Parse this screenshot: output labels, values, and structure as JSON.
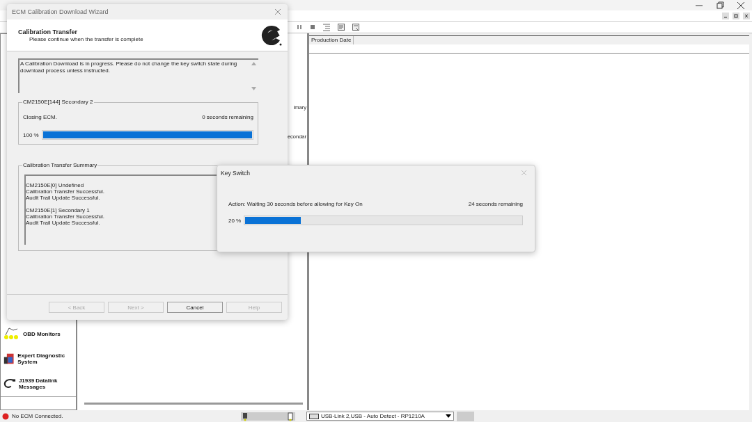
{
  "sidebar": {
    "items": [
      {
        "kind": "obd",
        "label": "OBD Monitors"
      },
      {
        "kind": "expert",
        "label": "Expert Diagnostic System"
      },
      {
        "kind": "datalink",
        "label": "J1939 Datalink Messages"
      }
    ]
  },
  "middle_pane": {
    "texts": [
      "imary",
      "econdar"
    ]
  },
  "table": {
    "columns": [
      "Production Date"
    ]
  },
  "status_bar": {
    "connection": "No ECM Connected.",
    "adapter": "USB-Link 2,USB - Auto Detect - RP1210A"
  },
  "wizard": {
    "title": "ECM Calibration Download Wizard",
    "heading": "Calibration Transfer",
    "subheading": "Please continue when the transfer is complete",
    "message": "A Calibration Download is in progress.  Please do not change the key switch state during download process unless instructed.",
    "progress_group": {
      "title": "CM2150E[144] Secondary 2",
      "status": "Closing ECM.",
      "remaining": "0 seconds remaining",
      "percent": "100 %",
      "level": 1
    },
    "summary": {
      "title": "Calibration Transfer Summary",
      "blocks": [
        {
          "lines": [
            "CM2150E[0] Undefined",
            "Calibration Transfer Successful.",
            "Audit Trail Update Successful."
          ]
        },
        {
          "lines": [
            "CM2150E[1] Secondary 1",
            "Calibration Transfer Successful.",
            "Audit Trail Update Successful."
          ]
        }
      ]
    },
    "buttons": [
      {
        "label": "< Back",
        "disabled": true
      },
      {
        "label": "Next >",
        "disabled": true
      },
      {
        "label": "Cancel",
        "disabled": false
      },
      {
        "label": "Help",
        "disabled": true
      }
    ]
  },
  "key_switch": {
    "title": "Key Switch",
    "action": "Action: Waiting 30 seconds before allowing for Key On",
    "remaining": "24 seconds remaining",
    "percent": "20 %",
    "level": 0.2
  }
}
